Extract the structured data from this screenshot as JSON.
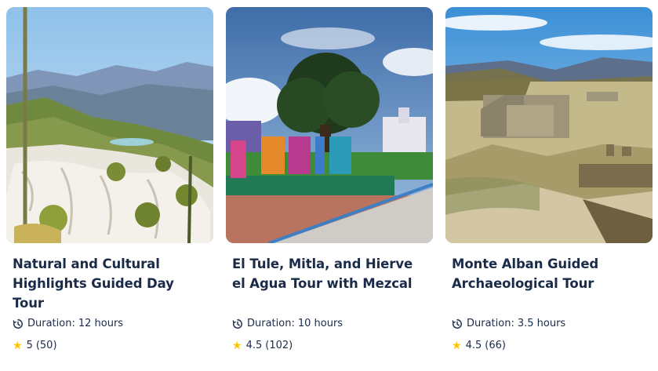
{
  "cards": [
    {
      "title": "Natural and Cultural Highlights Guided Day Tour",
      "duration_label": "Duration:",
      "duration_value": "12 hours",
      "rating": "5",
      "reviews": "(50)",
      "photo_icon": "mountain-landscape"
    },
    {
      "title": "El Tule, Mitla, and Hierve el Agua Tour with Mezcal",
      "duration_label": "Duration:",
      "duration_value": "10 hours",
      "rating": "4.5",
      "reviews": "(102)",
      "photo_icon": "town-square"
    },
    {
      "title": "Monte Alban Guided Archaeological Tour",
      "duration_label": "Duration:",
      "duration_value": "3.5 hours",
      "rating": "4.5",
      "reviews": "(66)",
      "photo_icon": "archaeological-site"
    }
  ],
  "colors": {
    "text": "#1a2b49",
    "star": "#fdc400"
  }
}
